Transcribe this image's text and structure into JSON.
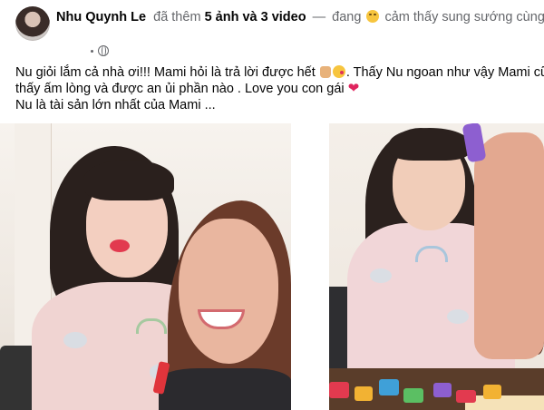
{
  "post": {
    "author": "Nhu Quynh Le",
    "action_prefix": "đã thêm",
    "media_count": "5 ảnh và 3 video",
    "dash": "—",
    "feeling_prefix": "đang",
    "feeling_text": "cảm thấy sung sướng cùng",
    "privacy_icon": "globe-icon",
    "text": {
      "line1_a": "Nu giỏi lắm cả nhà ơi!!! Mami hỏi là trả lời được hết",
      "line1_b": ". Thấy Nu ngoan như vậy Mami cũn",
      "line2": "thấy ấm lòng và được an ủi phần nào . Love you con gái",
      "line3": "Nu là tài sản lớn nhất  của Mami ..."
    },
    "emoji_heart": "❤"
  },
  "photos": [
    {
      "name": "photo-girl-and-mother-selfie"
    },
    {
      "name": "photo-girl-holding-purple-toy"
    }
  ],
  "colors": {
    "text_primary": "#050505",
    "text_secondary": "#65676b",
    "heart": "#e0245e"
  }
}
